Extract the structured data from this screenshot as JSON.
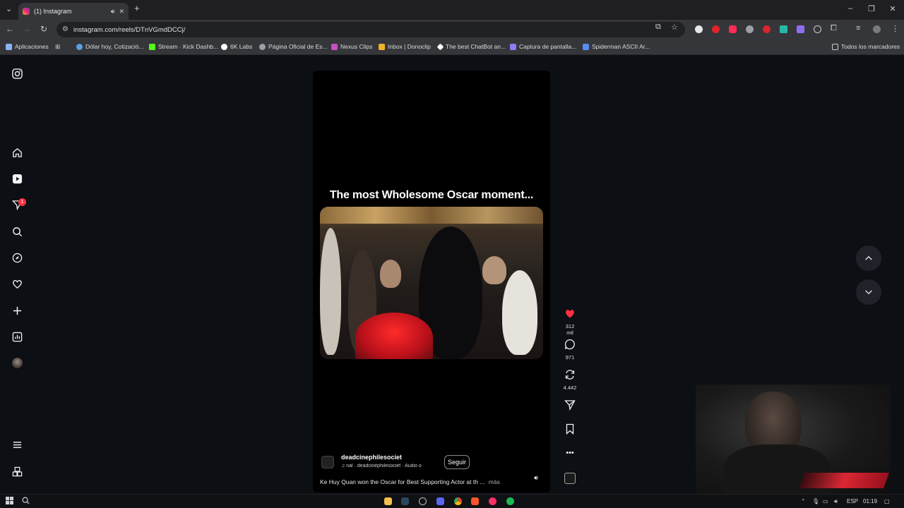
{
  "browser": {
    "tab_title": "(1) Instagram",
    "url": "instagram.com/reels/DTnVGmdDCCj/",
    "bookmarks": [
      {
        "label": "Aplicaciones",
        "color": "#8ab4f8"
      },
      {
        "label": "Dólar hoy, Cotizació...",
        "color": "#5aa0e6"
      },
      {
        "label": "Stream · Kick Dashb...",
        "color": "#53fc18"
      },
      {
        "label": "6K Labs",
        "color": "#ffffff"
      },
      {
        "label": "Página Oficial de Es...",
        "color": "#9aa0a6"
      },
      {
        "label": "Nexus Clips",
        "color": "#c850c0"
      },
      {
        "label": "Inbox | Donoclip",
        "color": "#f0b429"
      },
      {
        "label": "The best ChatBot an...",
        "color": "#ffffff"
      },
      {
        "label": "Captura de pantalla...",
        "color": "#8e7cf5"
      },
      {
        "label": "Spiderman ASCII Ar...",
        "color": "#5a8dee"
      }
    ],
    "all_bookmarks": "Todos los marcadores"
  },
  "instagram": {
    "notification_count": "1",
    "reel": {
      "caption": "The most Wholesome Oscar moment...",
      "username": "deadcinephilesociet",
      "audio": "nal · deadcinephilesociet · Audio o",
      "follow_label": "Seguir",
      "description": "Ke Huy Quan won the Oscar for Best Supporting Actor at th ...",
      "more_label": "más"
    },
    "actions": {
      "likes": "312 mil",
      "comments": "971",
      "reposts": "4.442"
    }
  },
  "taskbar": {
    "language": "ESP",
    "time": "01:19"
  },
  "colors": {
    "like": "#ff3040",
    "background": "#0c0f14"
  }
}
